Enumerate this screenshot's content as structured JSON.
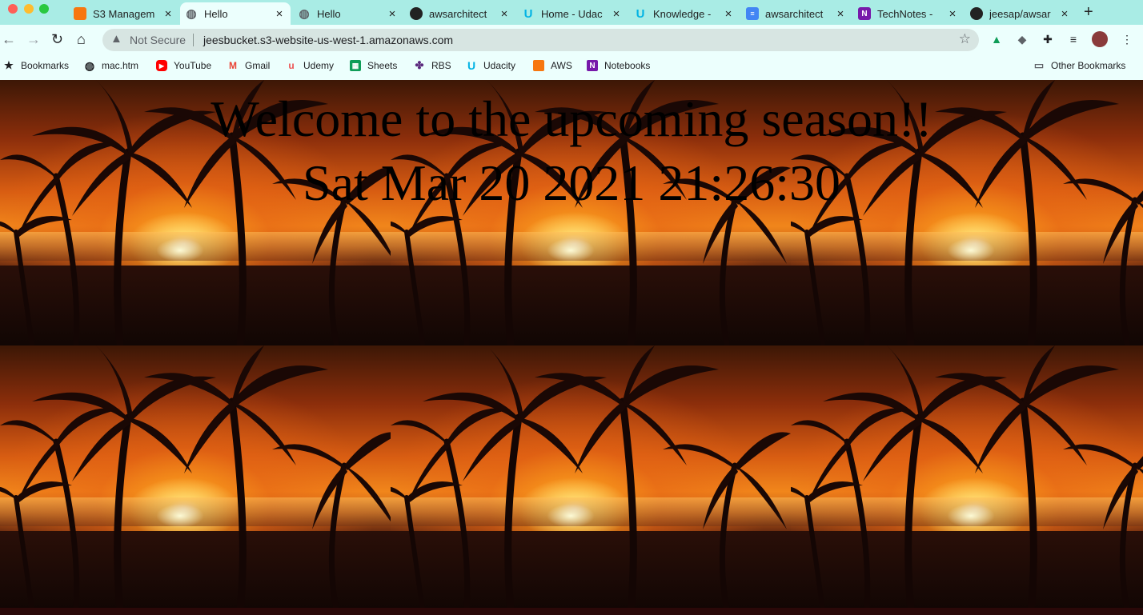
{
  "tabs": [
    {
      "title": "S3 Managem",
      "icon": "aws-cube-icon",
      "color": "#f7770f"
    },
    {
      "title": "Hello",
      "icon": "globe-icon",
      "color": "#5f6368",
      "active": true
    },
    {
      "title": "Hello",
      "icon": "globe-icon",
      "color": "#5f6368"
    },
    {
      "title": "awsarchitect",
      "icon": "github-icon",
      "color": "#222222"
    },
    {
      "title": "Home - Udac",
      "icon": "udacity-icon",
      "color": "#02b3e4"
    },
    {
      "title": "Knowledge -",
      "icon": "udacity-icon",
      "color": "#02b3e4"
    },
    {
      "title": "awsarchitect",
      "icon": "google-docs-icon",
      "color": "#4285f4"
    },
    {
      "title": "TechNotes -",
      "icon": "onenote-icon",
      "color": "#7719aa"
    },
    {
      "title": "jeesap/awsar",
      "icon": "github-icon",
      "color": "#222222"
    }
  ],
  "address_bar": {
    "security": "Not Secure",
    "url": "jeesbucket.s3-website-us-west-1.amazonaws.com"
  },
  "bookmarks": [
    {
      "label": "Bookmarks",
      "icon": "star-icon"
    },
    {
      "label": "mac.htm",
      "icon": "globe-icon"
    },
    {
      "label": "YouTube",
      "icon": "youtube-icon",
      "color": "#ff0000"
    },
    {
      "label": "Gmail",
      "icon": "gmail-icon",
      "color": "#ea4335"
    },
    {
      "label": "Udemy",
      "icon": "udemy-icon",
      "color": "#ec5252"
    },
    {
      "label": "Sheets",
      "icon": "sheets-icon",
      "color": "#0f9d58"
    },
    {
      "label": "RBS",
      "icon": "rbs-icon",
      "color": "#5a287d"
    },
    {
      "label": "Udacity",
      "icon": "udacity-icon",
      "color": "#02b3e4"
    },
    {
      "label": "AWS",
      "icon": "aws-cube-icon",
      "color": "#f7770f"
    },
    {
      "label": "Notebooks",
      "icon": "onenote-icon",
      "color": "#7719aa"
    }
  ],
  "other_bookmarks": "Other Bookmarks",
  "page": {
    "headline": "Welcome to the upcoming season!!",
    "datetime": "Sat Mar 20 2021 21:26:30"
  }
}
